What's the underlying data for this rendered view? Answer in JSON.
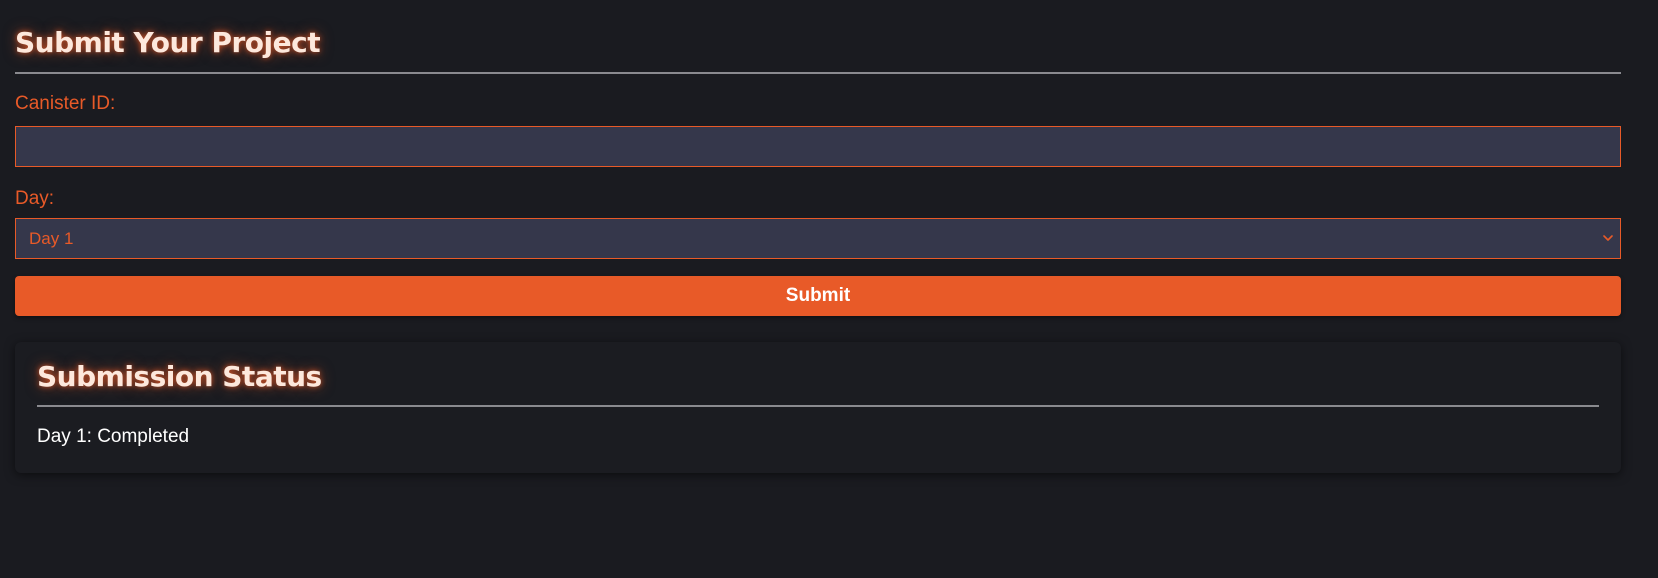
{
  "page": {
    "title": "Submit Your Project"
  },
  "form": {
    "canister_label": "Canister ID:",
    "canister_value": "",
    "canister_placeholder": "",
    "day_label": "Day:",
    "day_selected": "Day 1",
    "submit_label": "Submit"
  },
  "status": {
    "title": "Submission Status",
    "entries": [
      {
        "text": "Day 1: Completed"
      }
    ]
  },
  "colors": {
    "background": "#1a1b20",
    "accent": "#e85a28",
    "input_background": "#35374b",
    "title_text": "#fde8dc"
  },
  "icons": {
    "select_arrow": "chevron-down-icon"
  }
}
